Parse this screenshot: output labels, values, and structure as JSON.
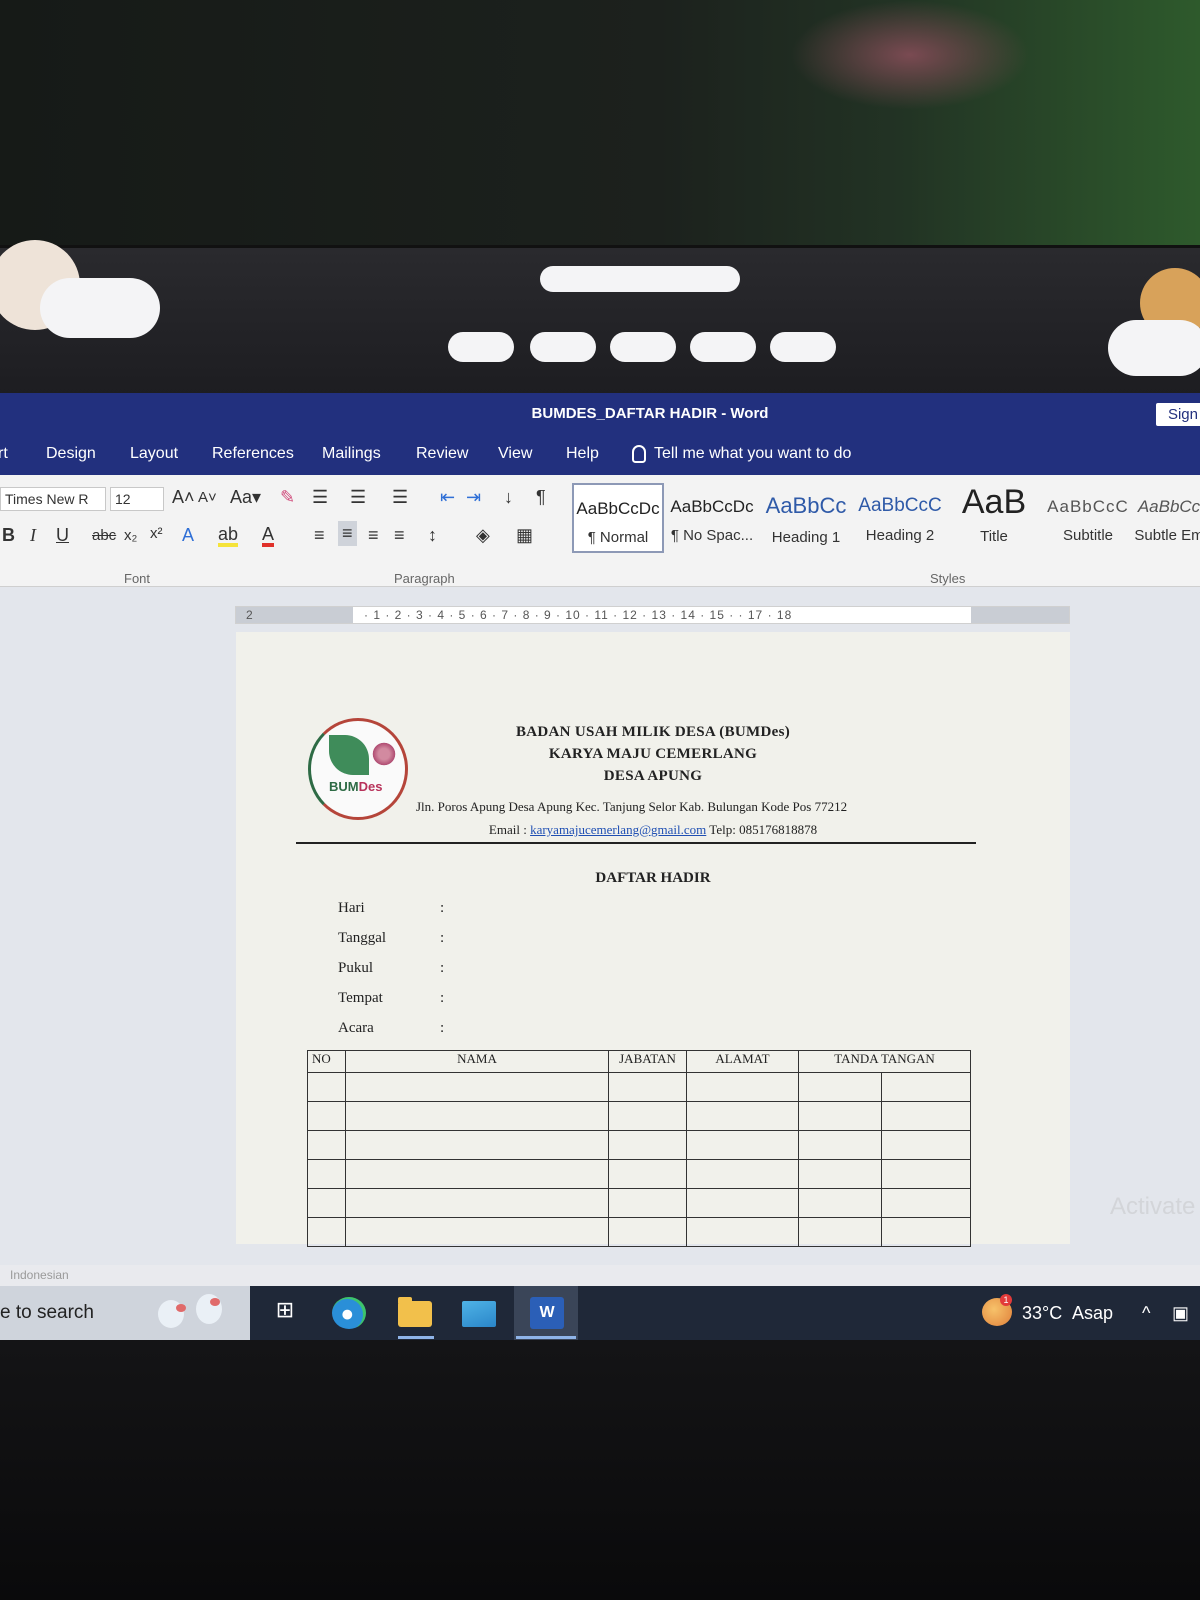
{
  "window": {
    "title": "BUMDES_DAFTAR HADIR  -  Word",
    "sign_in": "Sign"
  },
  "menu": {
    "tabs": [
      "rt",
      "Design",
      "Layout",
      "References",
      "Mailings",
      "Review",
      "View",
      "Help"
    ],
    "tell_me": "Tell me what you want to do"
  },
  "ribbon": {
    "font_name": "Times New R",
    "font_size": "12",
    "groups": {
      "font": "Font",
      "paragraph": "Paragraph",
      "styles": "Styles"
    },
    "styles": [
      {
        "sample": "AaBbCcDc",
        "name": "¶ Normal"
      },
      {
        "sample": "AaBbCcDc",
        "name": "¶ No Spac..."
      },
      {
        "sample": "AaBbCc",
        "name": "Heading 1"
      },
      {
        "sample": "AaBbCcC",
        "name": "Heading 2"
      },
      {
        "sample": "AaB",
        "name": "Title"
      },
      {
        "sample": "AaBbCcC",
        "name": "Subtitle"
      },
      {
        "sample": "AaBbCc",
        "name": "Subtle Em"
      }
    ]
  },
  "ruler": {
    "left": "2",
    "numbers": "· 1 · 2 · 3 · 4 · 5 · 6 · 7 · 8 · 9 · 10 · 11 · 12 · 13 · 14 · 15 ·    · 17 · 18"
  },
  "document": {
    "logo_text_a": "BUM",
    "logo_text_b": "Des",
    "heading1": "BADAN USAH MILIK DESA (BUMDes)",
    "heading2": "KARYA MAJU CEMERLANG",
    "heading3": "DESA APUNG",
    "address": "Jln. Poros Apung Desa Apung Kec. Tanjung Selor Kab. Bulungan Kode Pos 77212",
    "email_label": "Email : ",
    "email": "karyamajucemerlang@gmail.com",
    "phone": " Telp: 085176818878",
    "title": "DAFTAR HADIR",
    "fields": [
      {
        "label": "Hari",
        "colon": ":"
      },
      {
        "label": "Tanggal",
        "colon": ":"
      },
      {
        "label": "Pukul",
        "colon": ":"
      },
      {
        "label": "Tempat",
        "colon": ":"
      },
      {
        "label": "Acara",
        "colon": ":"
      }
    ],
    "table_headers": [
      "NO",
      "NAMA",
      "JABATAN",
      "ALAMAT",
      "TANDA TANGAN"
    ]
  },
  "status": {
    "language": "Indonesian",
    "watermark": "Activate"
  },
  "taskbar": {
    "search_text": "e to search",
    "weather_badge": "1",
    "temperature": "33°C",
    "weather_text": "Asap",
    "tray_arrow": "^"
  }
}
